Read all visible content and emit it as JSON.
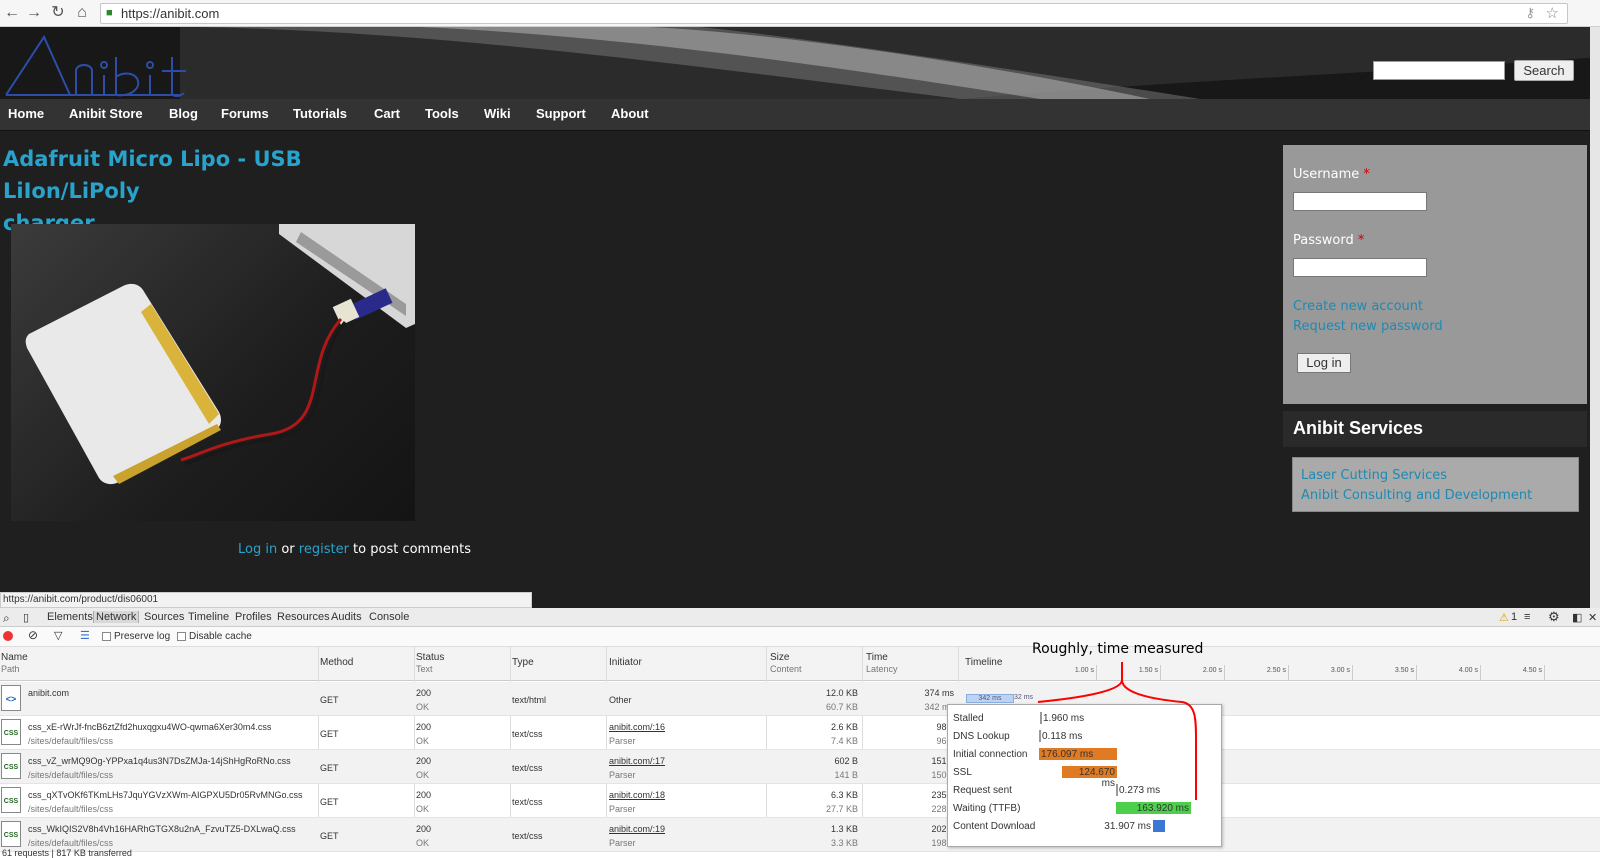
{
  "browser": {
    "url": "https://anibit.com"
  },
  "site": {
    "search": {
      "button": "Search"
    },
    "nav": [
      "Home",
      "Anibit Store",
      "Blog",
      "Forums",
      "Tutorials",
      "Cart",
      "Tools",
      "Wiki",
      "Support",
      "About"
    ],
    "title_line1": "Adafruit Micro Lipo - USB LiIon/LiPoly",
    "title_line2": "charger",
    "comment": {
      "login": "Log in",
      "or": " or ",
      "register": "register",
      "rest": " to post comments"
    },
    "login": {
      "username_label": "Username",
      "password_label": "Password",
      "required": "*",
      "create": "Create new account",
      "request": "Request new password",
      "button": "Log in"
    },
    "services": {
      "heading": "Anibit Services",
      "items": [
        "Laser Cutting Services",
        "Anibit Consulting and Development"
      ]
    },
    "status_url": "https://anibit.com/product/dis06001"
  },
  "devtools": {
    "tabs": [
      "Elements",
      "Network",
      "Sources",
      "Timeline",
      "Profiles",
      "Resources",
      "Audits",
      "Console"
    ],
    "warning_count": "1",
    "preserve_log": "Preserve log",
    "disable_cache": "Disable cache",
    "columns": {
      "name": "Name",
      "path": "Path",
      "method": "Method",
      "status": "Status",
      "text": "Text",
      "type": "Type",
      "initiator": "Initiator",
      "size": "Size",
      "content": "Content",
      "time": "Time",
      "latency": "Latency",
      "timeline": "Timeline"
    },
    "ticks": [
      "1.00 s",
      "1.50 s",
      "2.00 s",
      "2.50 s",
      "3.00 s",
      "3.50 s",
      "4.00 s",
      "4.50 s"
    ],
    "rows": [
      {
        "icon": "<>",
        "name": "anibit.com",
        "path": "",
        "method": "GET",
        "status": "200",
        "status_text": "OK",
        "type": "text/html",
        "initiator": "Other",
        "initiator_sub": "",
        "size": "12.0 KB",
        "content": "60.7 KB",
        "time": "374 ms",
        "latency": "342 ms"
      },
      {
        "icon": "CSS",
        "name": "css_xE-rWrJf-fncB6ztZfd2huxqgxu4WO-qwma6Xer30m4.css",
        "path": "/sites/default/files/css",
        "method": "GET",
        "status": "200",
        "status_text": "OK",
        "type": "text/css",
        "initiator": "anibit.com/:16",
        "initiator_sub": "Parser",
        "size": "2.6 KB",
        "content": "7.4 KB",
        "time": "98 n",
        "latency": "96 n"
      },
      {
        "icon": "CSS",
        "name": "css_vZ_wrMQ9Og-YPPxa1q4us3N7DsZMJa-14jShHgRoRNo.css",
        "path": "/sites/default/files/css",
        "method": "GET",
        "status": "200",
        "status_text": "OK",
        "type": "text/css",
        "initiator": "anibit.com/:17",
        "initiator_sub": "Parser",
        "size": "602 B",
        "content": "141 B",
        "time": "151 n",
        "latency": "150 n"
      },
      {
        "icon": "CSS",
        "name": "css_qXTvOKf6TKmLHs7JquYGVzXWm-AIGPXU5Dr05RvMNGo.css",
        "path": "/sites/default/files/css",
        "method": "GET",
        "status": "200",
        "status_text": "OK",
        "type": "text/css",
        "initiator": "anibit.com/:18",
        "initiator_sub": "Parser",
        "size": "6.3 KB",
        "content": "27.7 KB",
        "time": "235 n",
        "latency": "228 n"
      },
      {
        "icon": "CSS",
        "name": "css_WkIQIS2V8h4Vh16HARhGTGX8u2nA_FzvuTZ5-DXLwaQ.css",
        "path": "/sites/default/files/css",
        "method": "GET",
        "status": "200",
        "status_text": "OK",
        "type": "text/css",
        "initiator": "anibit.com/:19",
        "initiator_sub": "Parser",
        "size": "1.3 KB",
        "content": "3.3 KB",
        "time": "202 n",
        "latency": "198 n"
      }
    ],
    "row0_bar_label": "342 ms",
    "row0_bar_end": "32 ms",
    "timing": [
      {
        "label": "Stalled",
        "value": "1.960 ms",
        "color": "#999999"
      },
      {
        "label": "DNS Lookup",
        "value": "0.118 ms",
        "color": "#999999"
      },
      {
        "label": "Initial connection",
        "value": "176.097 ms",
        "color": "#e07b24"
      },
      {
        "label": "SSL",
        "value": "124.670 ms",
        "color": "#e07b24"
      },
      {
        "label": "Request sent",
        "value": "0.273 ms",
        "color": "#999999"
      },
      {
        "label": "Waiting (TTFB)",
        "value": "163.920 ms",
        "color": "#4cd04c"
      },
      {
        "label": "Content Download",
        "value": "31.907 ms",
        "color": "#3a78d4"
      }
    ],
    "summary": "61 requests  |  817 KB transferred"
  },
  "annotation": "Roughly, time measured",
  "colors": {
    "accent": "#29a3cc",
    "link": "#1e8ab3",
    "annotation": "#ff0000"
  }
}
